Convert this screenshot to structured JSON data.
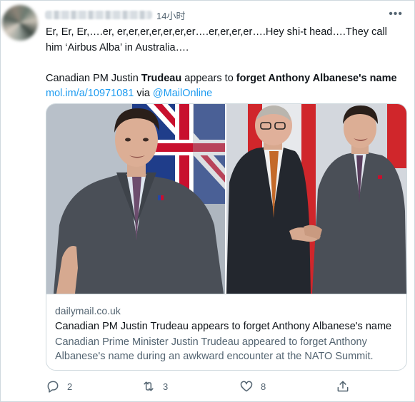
{
  "header": {
    "timestamp": "14小时",
    "more_glyph": "•••"
  },
  "tweet": {
    "line1": "Er, Er, Er,….er, er,er,er,er,er,er,er….er,er,er,er….Hey shi-t head….They call",
    "line2": "him ‘Airbus Alba’ in Australia….",
    "headline_part1": "Canadian PM Justin ",
    "headline_bold1": "Trudeau",
    "headline_part2": " appears to ",
    "headline_bold2": "forget Anthony Albanese's name",
    "short_link": "mol.im/a/10971081",
    "via_text": " via ",
    "via_handle": "@MailOnline"
  },
  "card": {
    "domain": "dailymail.co.uk",
    "title": "Canadian PM Justin Trudeau appears to forget Anthony Albanese's name",
    "description": "Canadian Prime Minister Justin Trudeau appeared to forget Anthony Albanese's name during an awkward encounter at the NATO Summit."
  },
  "actions": {
    "reply_count": "2",
    "retweet_count": "3",
    "like_count": "8",
    "reply_icon": "reply-icon",
    "retweet_icon": "retweet-icon",
    "like_icon": "heart-icon",
    "share_icon": "share-icon"
  },
  "colors": {
    "link": "#1d9bf0",
    "muted": "#536471",
    "text": "#0f1419",
    "border": "#cfd9de"
  }
}
